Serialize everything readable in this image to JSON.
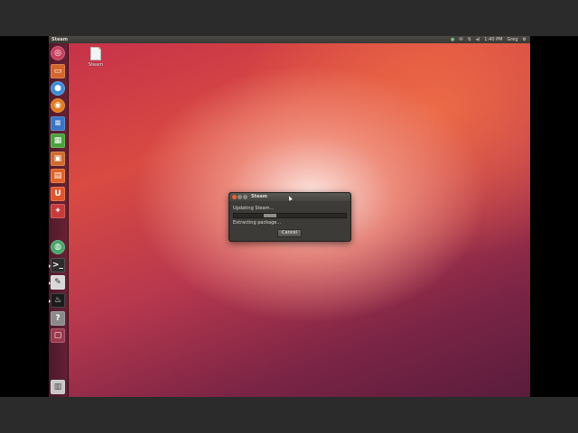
{
  "top_panel": {
    "app_title": "Steam",
    "indicators": {
      "steam_icon": "steam-tray-icon",
      "mail_icon": "mail-icon",
      "network_icon": "network-icon",
      "volume_icon": "volume-icon",
      "clock": "1:40 PM",
      "user": "Greg",
      "gear_icon": "gear-icon"
    }
  },
  "launcher": {
    "items": [
      {
        "name": "dash-home",
        "color": "#c7405e"
      },
      {
        "name": "files",
        "color": "#d4662a"
      },
      {
        "name": "chromium",
        "color": "#3b8ed8"
      },
      {
        "name": "firefox",
        "color": "#e07a1e"
      },
      {
        "name": "libreoffice-writer",
        "color": "#3a74c4"
      },
      {
        "name": "libreoffice-calc",
        "color": "#4aa23c"
      },
      {
        "name": "libreoffice-impress",
        "color": "#d06a2c"
      },
      {
        "name": "ubuntu-software-center",
        "color": "#e06226"
      },
      {
        "name": "ubuntu-one",
        "color": "#e0552a"
      },
      {
        "name": "system-settings",
        "color": "#c93b3b"
      },
      {
        "name": "workspace-switcher",
        "color": "#47a56b"
      },
      {
        "name": "terminal",
        "color": "#2c2c2c"
      },
      {
        "name": "text-editor",
        "color": "#d8d8d8"
      },
      {
        "name": "steam",
        "color": "#1b1b1b"
      },
      {
        "name": "unknown-app",
        "color": "#8a8a8a"
      },
      {
        "name": "workspaces",
        "color": "#9a3a4e"
      },
      {
        "name": "trash",
        "color": "#c8c8c8"
      }
    ]
  },
  "desktop": {
    "file_label": "Steam"
  },
  "dialog": {
    "title": "Steam",
    "status": "Updating Steam...",
    "progress": 0.32,
    "substatus": "Extracting package...",
    "cancel_label": "Cancel"
  }
}
